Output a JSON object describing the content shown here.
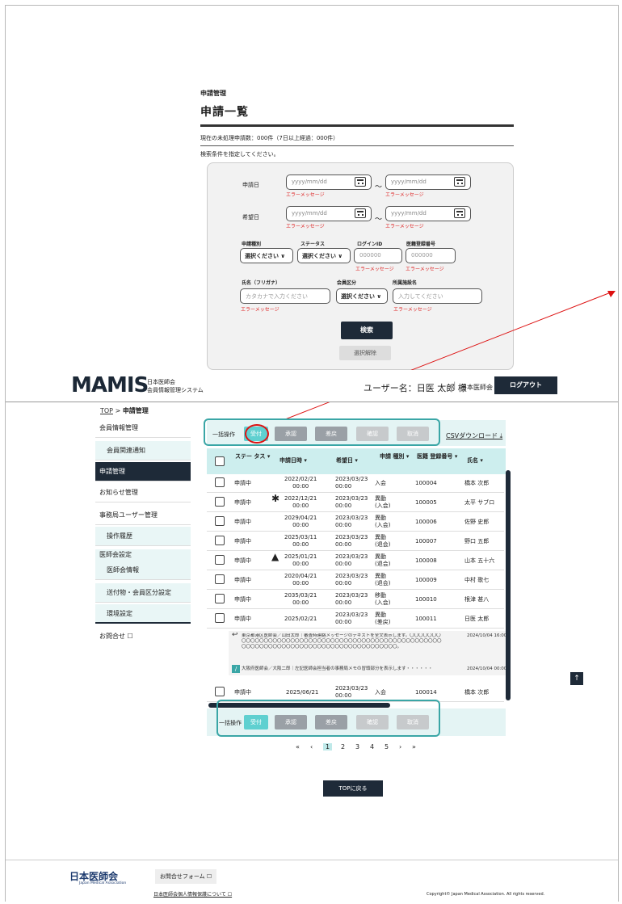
{
  "search": {
    "breadcrumb": "申請管理",
    "title": "申請一覧",
    "pending_count": "現在の未処理申請数：000件（7日以上経過：000件）",
    "hint": "検索条件を指定してください。",
    "date_placeholder": "yyyy/mm/dd",
    "error": "エラーメッセージ",
    "tilde": "～",
    "apply_date_label": "申請日",
    "wish_date_label": "希望日",
    "type_label": "申請種別",
    "status_label": "ステータス",
    "login_label": "ログインID",
    "reg_no_label": "医籍登録番号",
    "select_placeholder": "選択ください ∨",
    "id_placeholder": "000000",
    "kana_label": "氏名（フリガナ）",
    "kana_placeholder": "カタカナで入力ください",
    "member_label": "会員区分",
    "facility_label": "所属施設名",
    "facility_placeholder": "入力してください",
    "search_button": "検索",
    "clear_button": "選択解除"
  },
  "header": {
    "logo": "MAMIS",
    "logo_sub1": "日本医師会",
    "logo_sub2": "会員情報管理システム",
    "user": "ユーザー名：日医 太郎 様",
    "separator": "|",
    "org": "日本医師会",
    "logout": "ログアウト"
  },
  "breadcrumb": {
    "top": "TOP",
    "sep": ">",
    "current": "申請管理"
  },
  "sidebar": [
    {
      "label": "会員情報管理",
      "type": "item"
    },
    {
      "label": "会員関連通知",
      "type": "sub"
    },
    {
      "label": "申請管理",
      "type": "active"
    },
    {
      "label": "お知らせ管理",
      "type": "item"
    },
    {
      "label": "事務局ユーザー管理",
      "type": "item"
    },
    {
      "label": "操作履歴",
      "type": "sub"
    },
    {
      "label": "医師会設定",
      "type": "group"
    },
    {
      "label": "医師会情報",
      "type": "sub"
    },
    {
      "label": "送付物・会員区分設定",
      "type": "sub"
    },
    {
      "label": "環境設定",
      "type": "sub"
    },
    {
      "label": "お問合せ ☐",
      "type": "item"
    }
  ],
  "ops": {
    "label": "一括操作",
    "accept": "受付",
    "approve": "承認",
    "reject": "差戻",
    "confirm": "確認",
    "cancel": "取消",
    "csv": "CSVダウンロード ⤓",
    "colors": {
      "accept": "#5fd0d0",
      "approve": "#9aa0a6",
      "reject": "#9aa0a6",
      "confirm": "#c7cacc",
      "cancel": "#c7cacc"
    }
  },
  "table": {
    "headers": [
      "ステー\nタス ▾",
      "申請日時 ▾",
      "希望日 ▾",
      "申請\n種別 ▾",
      "医籍\n登録番号 ▾",
      "氏名 ▾"
    ],
    "rows": [
      {
        "status": "申請中",
        "applied": "2022/02/21\n00:00",
        "wish": "2023/03/23\n00:00",
        "type": "入会",
        "no": "100004",
        "name": "橋本 次郎",
        "icon": ""
      },
      {
        "status": "申請中",
        "applied": "2022/12/21\n00:00",
        "wish": "2023/03/23\n00:00",
        "type": "異動\n(入会)",
        "no": "100005",
        "name": "太平 サブロ",
        "icon": "✱"
      },
      {
        "status": "申請中",
        "applied": "2029/04/21\n00:00",
        "wish": "2023/03/23\n00:00",
        "type": "異動\n(入会)",
        "no": "100006",
        "name": "佐野 史郎",
        "icon": ""
      },
      {
        "status": "申請中",
        "applied": "2025/03/11\n00:00",
        "wish": "2023/03/23\n00:00",
        "type": "異動\n(退会)",
        "no": "100007",
        "name": "野口 五郎",
        "icon": ""
      },
      {
        "status": "申請中",
        "applied": "2025/01/21\n00:00",
        "wish": "2023/03/23\n00:00",
        "type": "異動\n(退会)",
        "no": "100008",
        "name": "山本 五十六",
        "icon": "▲"
      },
      {
        "status": "申請中",
        "applied": "2020/04/21\n00:00",
        "wish": "2023/03/23\n00:00",
        "type": "異動\n(退会)",
        "no": "100009",
        "name": "中村 歌七",
        "icon": ""
      },
      {
        "status": "申請中",
        "applied": "2035/03/21\n00:00",
        "wish": "2023/03/23\n00:00",
        "type": "移動\n(入会)",
        "no": "100010",
        "name": "根津 甚八",
        "icon": ""
      },
      {
        "status": "申請中",
        "applied": "2025/02/21",
        "wish": "2023/03/23\n00:00",
        "type": "異動\n(差戻)",
        "no": "100011",
        "name": "日医 太郎",
        "icon": ""
      }
    ],
    "memo1": "東京都港区医師会／山田太郎｜審査時連絡メッセージのテキストを全文表示します。〇〇〇〇〇〇〇〇〇〇〇〇〇〇〇〇〇〇〇〇〇〇〇〇〇〇〇〇〇〇〇〇〇〇〇〇〇〇〇〇〇〇〇〇〇〇〇〇〇〇〇〇〇〇〇〇〇〇〇〇〇〇〇〇〇〇〇〇〇〇〇〇〇〇〇〇〇〇〇〇〇〇〇〇〇〇〇。",
    "memo1_time": "2024/10/04 16:00",
    "memo2": "大阪府医師会／大阪二郎｜左記医師会担当者の事務局メモの冒頭部分を表示します・・・・・・",
    "memo2_time": "2024/10/04 00:00",
    "last_row": {
      "status": "申請中",
      "applied": "2025/06/21",
      "wish": "2023/03/23\n00:00",
      "type": "入会",
      "no": "100014",
      "name": "橋本 次郎"
    }
  },
  "pager": {
    "first": "«",
    "prev": "‹",
    "pages": [
      "1",
      "2",
      "3",
      "4",
      "5"
    ],
    "next": "›",
    "last": "»",
    "current": "1"
  },
  "top_button": "TOPに戻る",
  "scroll_top": "↑",
  "footer": {
    "logo": "日本医師会",
    "logo_sub": "Japan Medical Association",
    "contact": "お問合せフォーム ☐",
    "privacy": "日本医師会個人情報保護について ☐",
    "copyright": "Copyright© Japan Medical Association. All rights reserved."
  }
}
